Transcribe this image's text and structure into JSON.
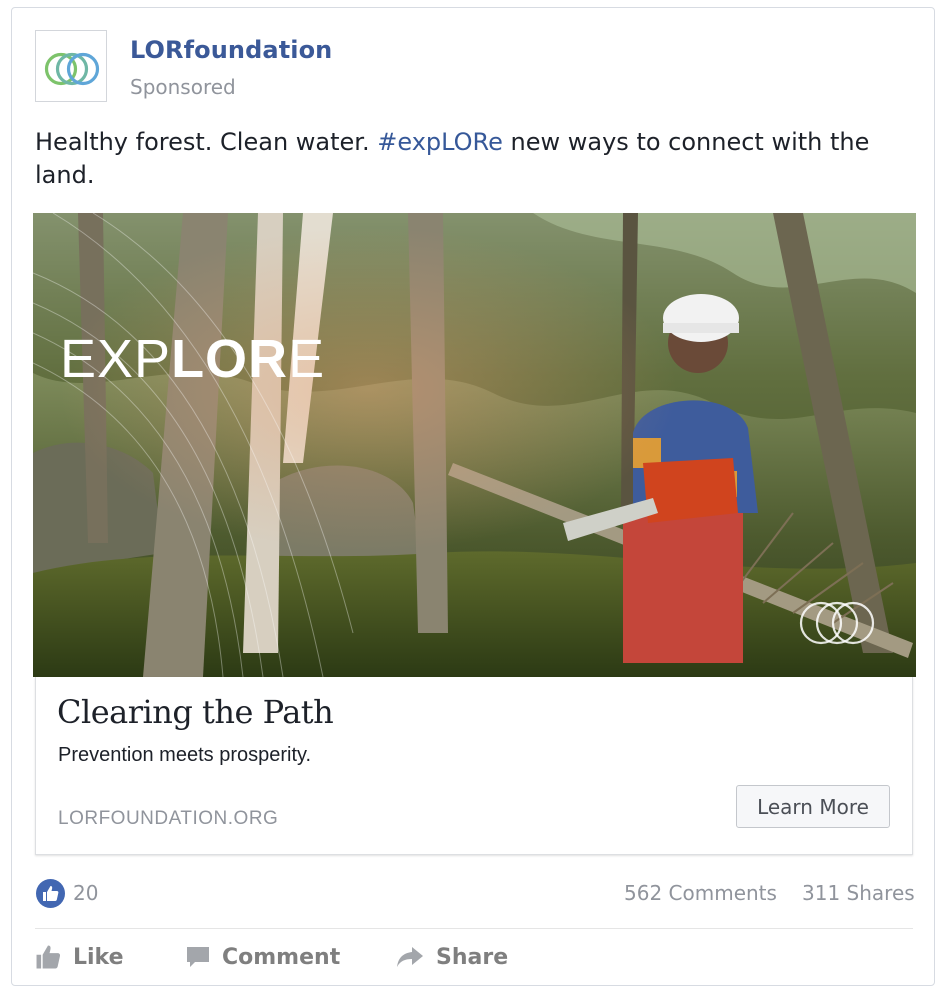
{
  "post": {
    "page_name": "LORfoundation",
    "sponsored_label": "Sponsored",
    "text_before": "Healthy forest. Clean water. ",
    "hashtag": "#expLORe",
    "text_after": " new ways to connect with the land."
  },
  "image": {
    "overlay_light": "EXP",
    "overlay_bold": "LOR",
    "overlay_end": "E"
  },
  "link": {
    "title": "Clearing the Path",
    "description": "Prevention meets prosperity.",
    "domain": "LORFOUNDATION.ORG",
    "cta_label": "Learn More"
  },
  "stats": {
    "likes": "20",
    "comments": "562 Comments",
    "shares": "311 Shares"
  },
  "actions": {
    "like_label": "Like",
    "comment_label": "Comment",
    "share_label": "Share"
  },
  "colors": {
    "brand_blue": "#3b5998",
    "hashtag_blue": "#365899",
    "like_badge": "#4267b2",
    "logo_green": "#7dc36b",
    "logo_blue": "#5fa6d8"
  }
}
